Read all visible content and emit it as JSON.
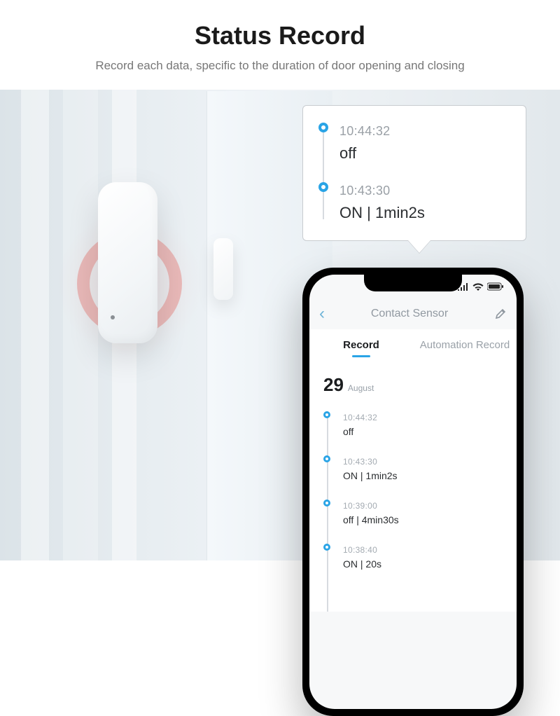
{
  "header": {
    "title": "Status Record",
    "subtitle": "Record each data, specific to the duration of door opening and closing"
  },
  "callout": {
    "items": [
      {
        "time": "10:44:32",
        "state": "off"
      },
      {
        "time": "10:43:30",
        "state": "ON   | 1min2s"
      }
    ]
  },
  "phone": {
    "app_title": "Contact Sensor",
    "tabs": {
      "record": "Record",
      "automation": "Automation Record"
    },
    "date": {
      "day": "29",
      "month": "August"
    },
    "records": [
      {
        "time": "10:44:32",
        "state": "off"
      },
      {
        "time": "10:43:30",
        "state": "ON   | 1min2s"
      },
      {
        "time": "10:39:00",
        "state": "off  | 4min30s"
      },
      {
        "time": "10:38:40",
        "state": "ON   | 20s"
      }
    ]
  }
}
